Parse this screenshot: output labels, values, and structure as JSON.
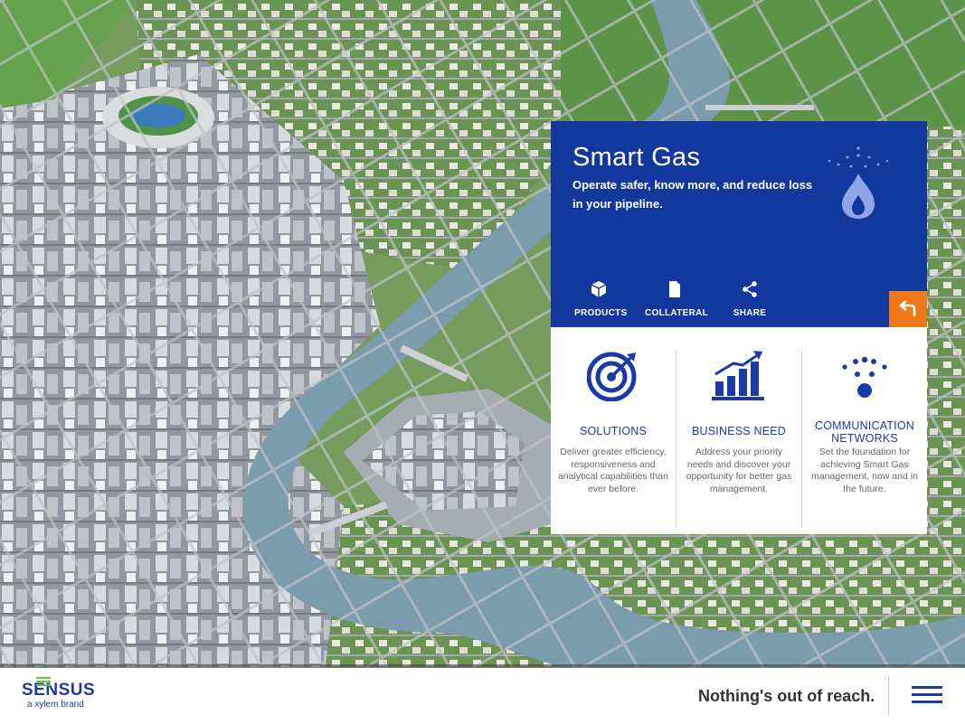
{
  "card": {
    "title": "Smart Gas",
    "subtitle": "Operate safer, know more, and reduce loss in your pipeline.",
    "actions": [
      {
        "label": "PRODUCTS",
        "icon": "box-icon"
      },
      {
        "label": "COLLATERAL",
        "icon": "document-icon"
      },
      {
        "label": "SHARE",
        "icon": "share-icon"
      }
    ],
    "columns": [
      {
        "heading": "SOLUTIONS",
        "text": "Deliver greater efficiency, responsiveness and analytical capabilities than ever before.",
        "icon": "target-icon"
      },
      {
        "heading": "BUSINESS NEED",
        "text": "Address your priority needs and discover your opportunity for better gas management.",
        "icon": "growth-chart-icon"
      },
      {
        "heading": "COMMUNICATION NETWORKS",
        "text": "Set the foundation for achieving Smart Gas management, now and in the future.",
        "icon": "network-dots-icon"
      }
    ]
  },
  "footer": {
    "brand": "SENSUS",
    "brand_sub": "a xylem brand",
    "tagline": "Nothing's out of reach."
  },
  "colors": {
    "card_blue": "#12389e",
    "accent_orange": "#f07818",
    "brand_blue": "#1a3aa8",
    "brand_green": "#6cc04a"
  }
}
